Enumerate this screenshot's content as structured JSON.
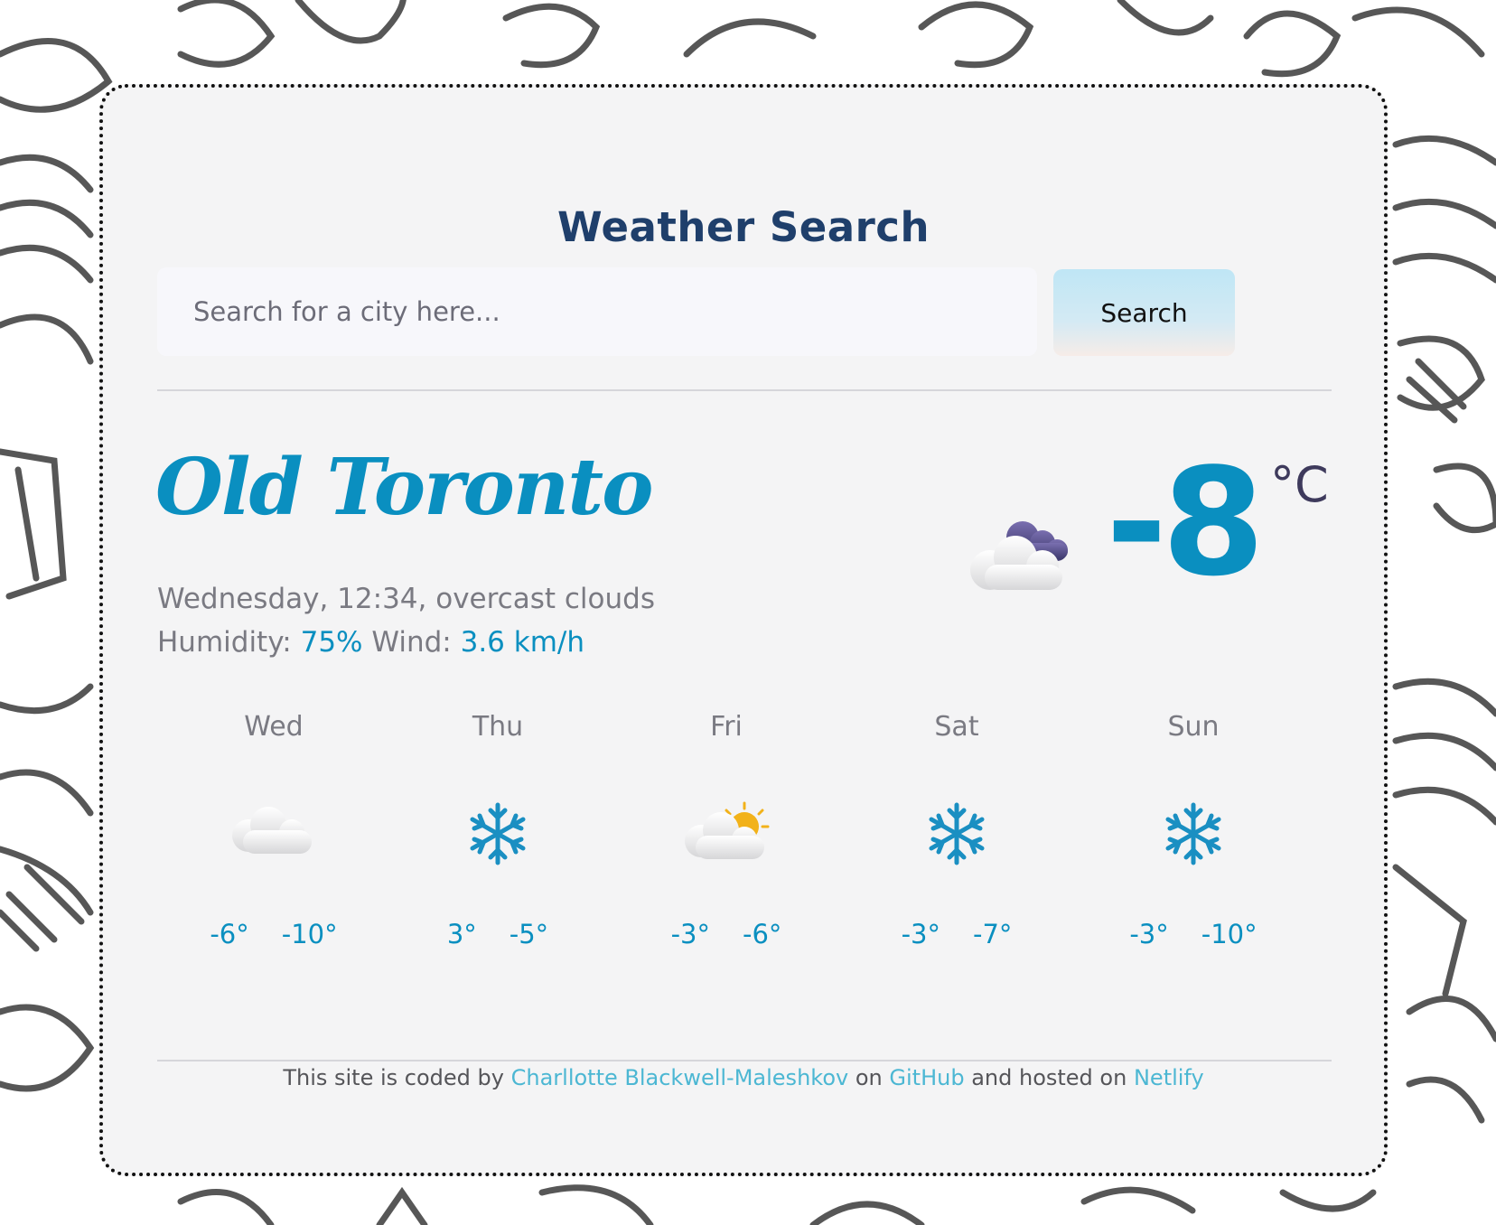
{
  "app": {
    "title": "Weather Search"
  },
  "search": {
    "placeholder": "Search for a city here...",
    "button_label": "Search"
  },
  "current": {
    "city": "Old Toronto",
    "description": "Wednesday, 12:34, overcast clouds",
    "humidity_label": "Humidity:",
    "humidity_value": "75%",
    "wind_label": "Wind:",
    "wind_value": "3.6 km/h",
    "temperature": "-8",
    "unit": "°C",
    "icon": "overcast-clouds-icon"
  },
  "forecast": [
    {
      "day": "Wed",
      "icon": "cloud-icon",
      "high": "-6°",
      "low": "-10°"
    },
    {
      "day": "Thu",
      "icon": "snowflake-icon",
      "high": "3°",
      "low": "-5°"
    },
    {
      "day": "Fri",
      "icon": "partly-cloudy-icon",
      "high": "-3°",
      "low": "-6°"
    },
    {
      "day": "Sat",
      "icon": "snowflake-icon",
      "high": "-3°",
      "low": "-7°"
    },
    {
      "day": "Sun",
      "icon": "snowflake-icon",
      "high": "-3°",
      "low": "-10°"
    }
  ],
  "footer": {
    "prefix": "This site is coded by",
    "author_link": "Charllotte Blackwell-Maleshkov",
    "on": "on",
    "github_link": "GitHub",
    "hosted": "and hosted on",
    "netlify_link": "Netlify"
  },
  "colors": {
    "accent": "#0a8fc0",
    "title": "#1f3f6b",
    "link": "#4cb7d3"
  }
}
